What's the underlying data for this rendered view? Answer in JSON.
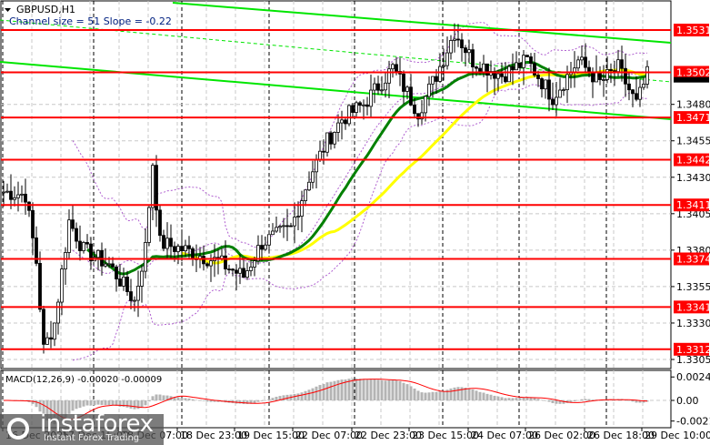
{
  "chart_data": {
    "type": "candlestick",
    "symbol_label": "GBPUSD,H1",
    "indicator_label": "Channel size = 51 Slope = -0.22",
    "macd_label": "MACD(12,26,9) -0.00020 -0.00009",
    "price_range": [
      1.3295,
      1.3555
    ],
    "macd_range": [
      -0.0024,
      0.0026
    ],
    "price_ticks": [
      "1.3480",
      "1.3455",
      "1.3430",
      "1.3405",
      "1.3380",
      "1.3355",
      "1.3330",
      "1.3305"
    ],
    "macd_ticks": [
      "0.00243",
      "0.00",
      "-0.00214"
    ],
    "current_price": "1.3500",
    "levels": [
      "1.3531",
      "1.3502",
      "1.3471",
      "1.3442",
      "1.3411",
      "1.3374",
      "1.3341",
      "1.3312"
    ],
    "x_labels": [
      "16 Dec 2025",
      "17 Dec 15:00",
      "18 Dec 07:00",
      "18 Dec 23:00",
      "19 Dec 15:00",
      "22 Dec 07:00",
      "22 Dec 23:00",
      "23 Dec 15:00",
      "24 Dec 07:00",
      "26 Dec 02:00",
      "26 Dec 18:00",
      "29 Dec 10:00"
    ],
    "price_anchors": [
      [
        0,
        1.342
      ],
      [
        6,
        1.3418
      ],
      [
        9,
        1.3372
      ],
      [
        11,
        1.3312
      ],
      [
        14,
        1.333
      ],
      [
        18,
        1.34
      ],
      [
        22,
        1.338
      ],
      [
        29,
        1.337
      ],
      [
        36,
        1.3345
      ],
      [
        39,
        1.3382
      ],
      [
        41,
        1.344
      ],
      [
        43,
        1.3385
      ],
      [
        50,
        1.338
      ],
      [
        59,
        1.3372
      ],
      [
        66,
        1.3362
      ],
      [
        71,
        1.3385
      ],
      [
        79,
        1.3395
      ],
      [
        84,
        1.343
      ],
      [
        89,
        1.3455
      ],
      [
        93,
        1.347
      ],
      [
        99,
        1.348
      ],
      [
        107,
        1.3505
      ],
      [
        114,
        1.3475
      ],
      [
        119,
        1.35
      ],
      [
        124,
        1.353
      ],
      [
        129,
        1.351
      ],
      [
        137,
        1.35
      ],
      [
        144,
        1.351
      ],
      [
        151,
        1.3485
      ],
      [
        158,
        1.351
      ],
      [
        164,
        1.3495
      ],
      [
        169,
        1.3505
      ],
      [
        174,
        1.348
      ],
      [
        177,
        1.35
      ]
    ],
    "colors": {
      "level": "#ff0000",
      "channel": "#00e600",
      "ma_fast": "#008000",
      "ma_slow": "#ffff00",
      "bands": "#b060d0",
      "signal": "#ff0000",
      "hist": "#b4b4b4"
    }
  },
  "watermark": {
    "brand": "instaforex",
    "tagline": "Instant Forex Trading"
  }
}
